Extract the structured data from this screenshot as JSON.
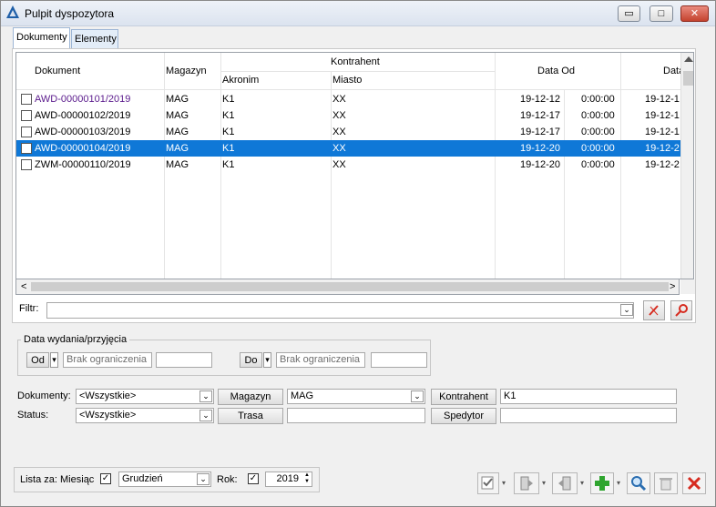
{
  "window": {
    "title": "Pulpit dyspozytora",
    "minimize": "▭",
    "maximize": "□",
    "close": "✕"
  },
  "tabs": [
    "Dokumenty",
    "Elementy"
  ],
  "grid": {
    "headers": {
      "dokument": "Dokument",
      "magazyn": "Magazyn",
      "kontrahent": "Kontrahent",
      "akronim": "Akronim",
      "miasto": "Miasto",
      "data_od": "Data Od",
      "data_do": "Data"
    },
    "rows": [
      {
        "dokument": "AWD-00000101/2019",
        "magazyn": "MAG",
        "akronim": "K1",
        "miasto": "XX",
        "data_od": "19-12-12",
        "czas_od": "0:00:00",
        "data_do": "19-12-1",
        "selected": false,
        "visited": true
      },
      {
        "dokument": "AWD-00000102/2019",
        "magazyn": "MAG",
        "akronim": "K1",
        "miasto": "XX",
        "data_od": "19-12-17",
        "czas_od": "0:00:00",
        "data_do": "19-12-1",
        "selected": false,
        "visited": false
      },
      {
        "dokument": "AWD-00000103/2019",
        "magazyn": "MAG",
        "akronim": "K1",
        "miasto": "XX",
        "data_od": "19-12-17",
        "czas_od": "0:00:00",
        "data_do": "19-12-1",
        "selected": false,
        "visited": false
      },
      {
        "dokument": "AWD-00000104/2019",
        "magazyn": "MAG",
        "akronim": "K1",
        "miasto": "XX",
        "data_od": "19-12-20",
        "czas_od": "0:00:00",
        "data_do": "19-12-2",
        "selected": true,
        "visited": false
      },
      {
        "dokument": "ZWM-00000110/2019",
        "magazyn": "MAG",
        "akronim": "K1",
        "miasto": "XX",
        "data_od": "19-12-20",
        "czas_od": "0:00:00",
        "data_do": "19-12-2",
        "selected": false,
        "visited": false
      }
    ]
  },
  "filter": {
    "label": "Filtr:",
    "value": ""
  },
  "date_group": {
    "legend": "Data wydania/przyjęcia",
    "from_label": "Od",
    "to_label": "Do",
    "from_placeholder": "Brak ograniczenia",
    "to_placeholder": "Brak ograniczenia"
  },
  "form": {
    "dokumenty_label": "Dokumenty:",
    "dokumenty_value": "<Wszystkie>",
    "status_label": "Status:",
    "status_value": "<Wszystkie>",
    "magazyn_button": "Magazyn",
    "magazyn_value": "MAG",
    "trasa_button": "Trasa",
    "trasa_value": "",
    "kontrahent_button": "Kontrahent",
    "kontrahent_value": "K1",
    "spedytor_button": "Spedytor",
    "spedytor_value": ""
  },
  "period": {
    "label": "Lista za: Miesiąc",
    "month": "Grudzień",
    "year_label": "Rok:",
    "year": "2019"
  },
  "colors": {
    "selection": "#0f78d7",
    "visited_link": "#5a1a8c",
    "add_green": "#2fa52f",
    "delete_red": "#d62b1f"
  }
}
